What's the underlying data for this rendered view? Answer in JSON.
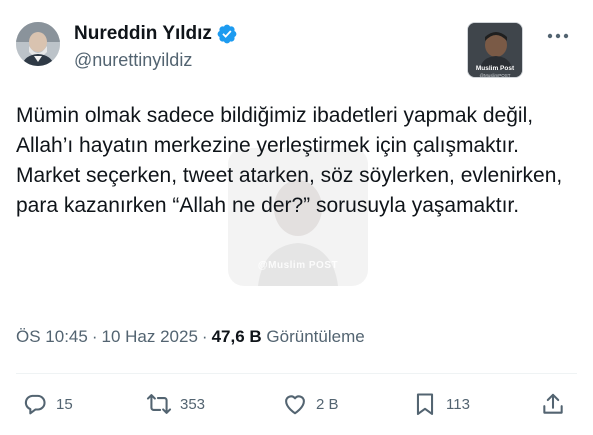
{
  "author": {
    "display_name": "Nureddin Yıldız",
    "handle": "@nurettinyildiz",
    "verified": true
  },
  "affiliate": {
    "name": "Muslim Post",
    "sub": "@MuslimPOST"
  },
  "watermark": {
    "text": "@Muslim POST"
  },
  "tweet": {
    "paragraphs": [
      "Mümin olmak sadece bildiğimiz ibadetleri yapmak değil, Allah’ı hayatın merkezine yerleştirmek için çalışmaktır.",
      "Market seçerken, tweet atarken, söz söylerken, evlenirken, para kazanırken “Allah ne der?” sorusuyla yaşamaktır."
    ]
  },
  "meta": {
    "time": "ÖS 10:45",
    "separator": "·",
    "date": "10 Haz 2025",
    "views_count": "47,6 B",
    "views_label": "Görüntüleme"
  },
  "actions": {
    "replies": "15",
    "retweets": "353",
    "likes": "2 B",
    "bookmarks": "113"
  },
  "colors": {
    "text_primary": "#0f1419",
    "text_secondary": "#536471",
    "verified_blue": "#1d9bf0",
    "divider": "#eff3f4"
  },
  "icons": {
    "verified": "verified-badge-icon",
    "more": "more-dots-icon",
    "reply": "reply-icon",
    "retweet": "retweet-icon",
    "like": "heart-icon",
    "bookmark": "bookmark-icon",
    "share": "share-icon"
  }
}
